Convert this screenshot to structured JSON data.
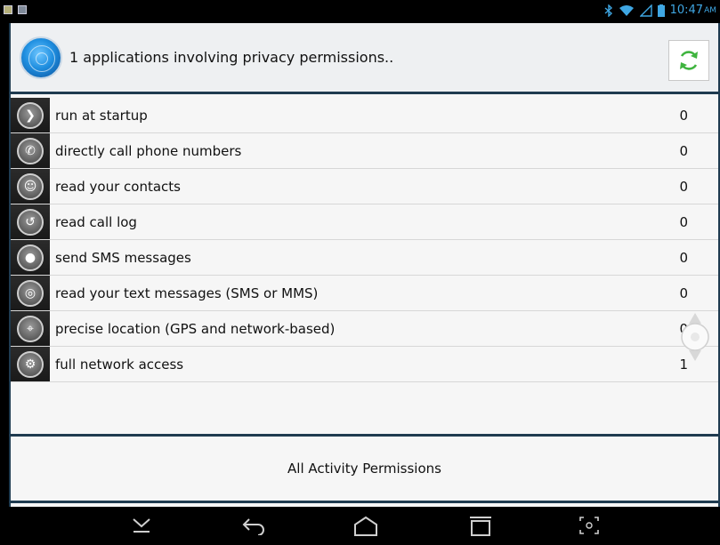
{
  "status_bar": {
    "time": "10:47",
    "ampm": "AM"
  },
  "header": {
    "title": "1 applications involving privacy permissions..",
    "refresh_icon": "refresh-icon",
    "accent": "#3fb43f"
  },
  "permissions": [
    {
      "label": "run at startup",
      "count": "0",
      "icon": "startup-icon"
    },
    {
      "label": "directly call phone numbers",
      "count": "0",
      "icon": "phone-icon"
    },
    {
      "label": "read your contacts",
      "count": "0",
      "icon": "contacts-icon"
    },
    {
      "label": "read call log",
      "count": "0",
      "icon": "call-log-icon"
    },
    {
      "label": "send SMS messages",
      "count": "0",
      "icon": "sms-icon"
    },
    {
      "label": "read your text messages (SMS or MMS)",
      "count": "0",
      "icon": "messages-icon"
    },
    {
      "label": "precise location (GPS and network-based)",
      "count": "0",
      "icon": "location-icon"
    },
    {
      "label": "full network access",
      "count": "1",
      "icon": "network-icon"
    }
  ],
  "footer": {
    "button_label": "All Activity Permissions"
  },
  "navbar": {
    "icons": [
      "chevron-down-icon",
      "back-icon",
      "home-icon",
      "recents-icon",
      "screenshot-icon"
    ]
  }
}
